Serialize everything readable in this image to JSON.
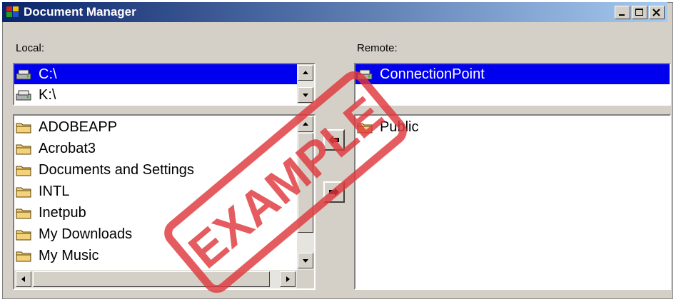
{
  "window": {
    "title": "Document Manager"
  },
  "local": {
    "label": "Local:",
    "drives": [
      {
        "name": "C:\\",
        "selected": true
      },
      {
        "name": "K:\\",
        "selected": false
      }
    ],
    "folders": [
      "ADOBEAPP",
      "Acrobat3",
      "Documents and Settings",
      "INTL",
      "Inetpub",
      "My Downloads",
      "My Music"
    ]
  },
  "remote": {
    "label": "Remote:",
    "connections": [
      {
        "name": "ConnectionPoint",
        "selected": true
      }
    ],
    "folders": [
      "Public"
    ]
  },
  "watermark": "EXAMPLE",
  "colors": {
    "titlebar_start": "#0a246a",
    "titlebar_end": "#a6caf0",
    "selection": "#0000ee",
    "stamp": "#e0393e"
  },
  "icons": {
    "drive": "drive-icon",
    "folder": "folder-icon",
    "copy_to_local": "left-arrow-icon",
    "copy_to_remote": "right-arrow-icon"
  }
}
